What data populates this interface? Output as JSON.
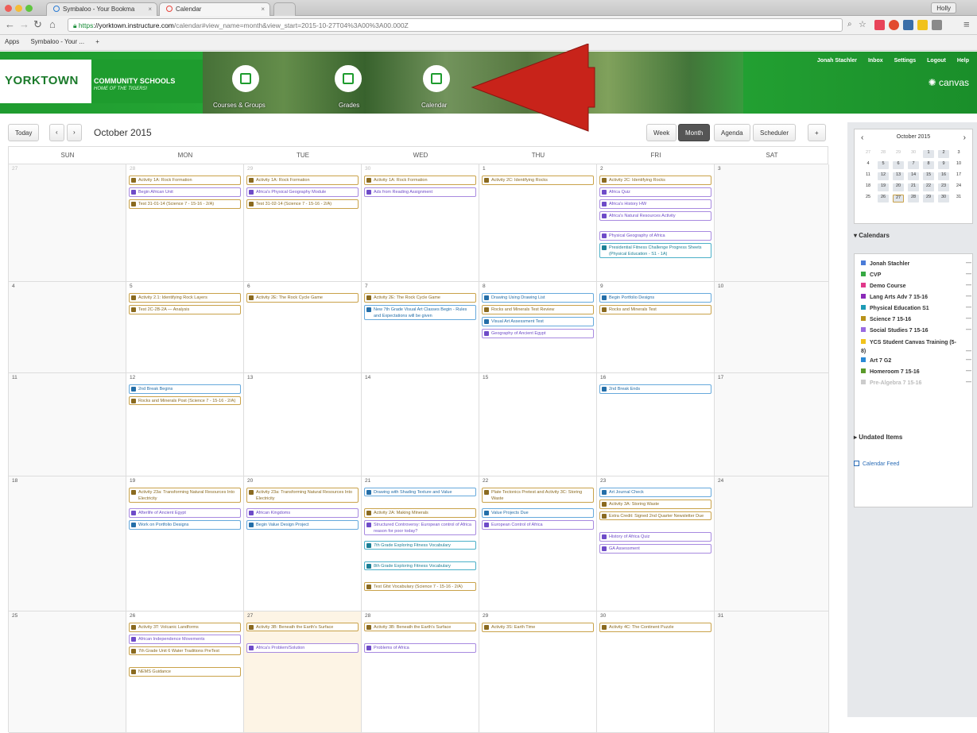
{
  "browser": {
    "tabs": [
      {
        "label": "Symbaloo - Your Bookma",
        "active": false
      },
      {
        "label": "Calendar",
        "active": true
      }
    ],
    "profile": "Holly",
    "url_secure": "https",
    "url_host": "://yorktown.instructure.com",
    "url_path": "/calendar#view_name=month&view_start=2015-10-27T04%3A00%3A00.000Z",
    "bookmarks": [
      "Apps",
      "Symbaloo - Your ...",
      "+"
    ]
  },
  "header": {
    "school_name": "YORKTOWN",
    "school_sub": "COMMUNITY SCHOOLS",
    "tagline": "HOME OF THE TIGERS!",
    "nav": [
      {
        "label": "Courses & Groups",
        "icon": "book-icon"
      },
      {
        "label": "Grades",
        "icon": "grades-icon"
      },
      {
        "label": "Calendar",
        "icon": "calendar-icon"
      }
    ],
    "user_links": [
      "Jonah Stachler",
      "Inbox",
      "Settings",
      "Logout",
      "Help"
    ],
    "brand": "canvas",
    "brand_color": "#21a534"
  },
  "toolbar": {
    "today_label": "Today",
    "prev_label": "‹",
    "next_label": "›",
    "month_title": "October 2015",
    "views": [
      "Week",
      "Month",
      "Agenda",
      "Scheduler"
    ],
    "selected_view": "Month",
    "add_label": "+"
  },
  "calendar": {
    "day_headers": [
      "SUN",
      "MON",
      "TUE",
      "WED",
      "THU",
      "FRI",
      "SAT"
    ],
    "weeks": [
      {
        "days": [
          {
            "num": "27",
            "dim": true,
            "events": []
          },
          {
            "num": "28",
            "dim": true,
            "events": [
              {
                "title": "Activity 1A: Rock Formation",
                "color": "olive"
              },
              {
                "title": "Begin African Unit",
                "color": "purple"
              },
              {
                "title": "Test 31-01-14 (Science 7 - 15-16 - 2/A)",
                "color": "olive"
              }
            ]
          },
          {
            "num": "29",
            "dim": true,
            "events": [
              {
                "title": "Activity 1A: Rock Formation",
                "color": "olive"
              },
              {
                "title": "Africa's Physical Geography Module",
                "color": "purple"
              },
              {
                "title": "Test 31-02-14 (Science 7 - 15-16 - 2/A)",
                "color": "olive"
              }
            ]
          },
          {
            "num": "30",
            "dim": true,
            "events": [
              {
                "title": "Activity 1A: Rock Formation",
                "color": "olive"
              },
              {
                "title": "Ads from Reading Assignment",
                "color": "purple"
              }
            ]
          },
          {
            "num": "1",
            "dim": false,
            "events": [
              {
                "title": "Activity 2C: Identifying Rocks",
                "color": "olive"
              }
            ]
          },
          {
            "num": "2",
            "dim": false,
            "events": [
              {
                "title": "Activity 2C: Identifying Rocks",
                "color": "olive"
              },
              {
                "title": "Africa Quiz",
                "color": "purple"
              },
              {
                "title": "Africa's History HW",
                "color": "purple"
              },
              {
                "title": "Africa's Natural Resources Activity",
                "color": "purple"
              },
              {
                "title": "Physical Geography of Africa",
                "color": "purple"
              },
              {
                "title": "Presidential Fitness Challenge Progress Sheets (Physical Education - S1 - 1A)",
                "color": "teal",
                "tall": true
              }
            ]
          },
          {
            "num": "3",
            "dim": false,
            "events": []
          }
        ]
      },
      {
        "days": [
          {
            "num": "4",
            "dim": false,
            "events": []
          },
          {
            "num": "5",
            "dim": false,
            "events": [
              {
                "title": "Activity 2.1: Identifying Rock Layers",
                "color": "olive"
              },
              {
                "title": "Test 2C-2B-2A — Analysis",
                "color": "olive"
              }
            ]
          },
          {
            "num": "6",
            "dim": false,
            "events": [
              {
                "title": "Activity 2E: The Rock Cycle Game",
                "color": "olive"
              }
            ]
          },
          {
            "num": "7",
            "dim": false,
            "events": [
              {
                "title": "Activity 2E: The Rock Cycle Game",
                "color": "olive"
              },
              {
                "title": "New 7th Grade Visual Art Classes Begin - Rules and Expectations will be given",
                "color": "blue",
                "tall": true
              }
            ]
          },
          {
            "num": "8",
            "dim": false,
            "events": [
              {
                "title": "Drawing Using Drawing List",
                "color": "blue"
              },
              {
                "title": "Rocks and Minerals Test Review",
                "color": "olive"
              },
              {
                "title": "Visual Art Assessment Test",
                "color": "blue"
              },
              {
                "title": "Geography of Ancient Egypt",
                "color": "purple"
              }
            ]
          },
          {
            "num": "9",
            "dim": false,
            "events": [
              {
                "title": "Begin Portfolio Designs",
                "color": "blue"
              },
              {
                "title": "Rocks and Minerals Test",
                "color": "olive"
              }
            ]
          },
          {
            "num": "10",
            "dim": false,
            "events": []
          }
        ]
      },
      {
        "days": [
          {
            "num": "11",
            "dim": false,
            "events": []
          },
          {
            "num": "12",
            "dim": false,
            "events": [
              {
                "title": "2nd Break Begins",
                "color": "blue"
              },
              {
                "title": "Rocks and Minerals Post (Science 7 - 15-16 - 2/A)",
                "color": "olive",
                "tall": true
              }
            ]
          },
          {
            "num": "13",
            "dim": false,
            "events": []
          },
          {
            "num": "14",
            "dim": false,
            "events": []
          },
          {
            "num": "15",
            "dim": false,
            "events": []
          },
          {
            "num": "16",
            "dim": false,
            "events": [
              {
                "title": "2nd Break Ends",
                "color": "blue"
              }
            ]
          },
          {
            "num": "17",
            "dim": false,
            "events": []
          }
        ]
      },
      {
        "days": [
          {
            "num": "18",
            "dim": false,
            "events": []
          },
          {
            "num": "19",
            "dim": false,
            "events": [
              {
                "title": "Activity 23a: Transforming Natural Resources Into Electricity",
                "color": "olive",
                "tall": true
              },
              {
                "title": "Afterlife of Ancient Egypt",
                "color": "purple"
              },
              {
                "title": "Work on Portfolio Designs",
                "color": "blue"
              }
            ]
          },
          {
            "num": "20",
            "dim": false,
            "events": [
              {
                "title": "Activity 23a: Transforming Natural Resources Into Electricity",
                "color": "olive",
                "tall": true
              },
              {
                "title": "African Kingdoms",
                "color": "purple"
              },
              {
                "title": "Begin Value Design Project",
                "color": "blue"
              }
            ]
          },
          {
            "num": "21",
            "dim": false,
            "events": [
              {
                "title": "Drawing with Shading Texture and Value",
                "color": "blue",
                "tall": true
              },
              {
                "title": "Activity 2A: Making Minerals",
                "color": "olive"
              },
              {
                "title": "Structured Controversy: European control of Africa reason for poor today?",
                "color": "purple",
                "tall": true
              },
              {
                "title": "7th Grade Exploring Fitness Vocabulary",
                "color": "teal",
                "tall": true
              },
              {
                "title": "8th Grade Exploring Fitness Vocabulary",
                "color": "teal",
                "tall": true
              },
              {
                "title": "Test Gfst Vocabulary (Science 7 - 15-16 - 2/A)",
                "color": "olive",
                "tall": true
              }
            ]
          },
          {
            "num": "22",
            "dim": false,
            "events": [
              {
                "title": "Plate Tectonics Pretest and Activity 3C: Storing Waste",
                "color": "olive",
                "tall": true
              },
              {
                "title": "Value Projects Due",
                "color": "blue"
              },
              {
                "title": "European Control of Africa",
                "color": "purple"
              }
            ]
          },
          {
            "num": "23",
            "dim": false,
            "events": [
              {
                "title": "Art Journal Check",
                "color": "blue"
              },
              {
                "title": "Activity 3A: Storing Waste",
                "color": "olive"
              },
              {
                "title": "Extra Credit: Signed 2nd Quarter Newsletter Due",
                "color": "olive",
                "tall": true
              },
              {
                "title": "History of Africa Quiz",
                "color": "purple"
              },
              {
                "title": "GA Assessment",
                "color": "purple"
              }
            ]
          },
          {
            "num": "24",
            "dim": false,
            "events": []
          }
        ]
      },
      {
        "days": [
          {
            "num": "25",
            "dim": false,
            "events": []
          },
          {
            "num": "26",
            "dim": false,
            "events": [
              {
                "title": "Activity 3T: Volcanic Landforms",
                "color": "olive"
              },
              {
                "title": "African Independence Movements",
                "color": "purple"
              },
              {
                "title": "7th Grade Unit 6 Water Traditions PreTest",
                "color": "olive",
                "tall": true
              },
              {
                "title": "NEMS Guidance",
                "color": "olive"
              }
            ]
          },
          {
            "num": "27",
            "dim": false,
            "today": true,
            "events": [
              {
                "title": "Activity 3B: Beneath the Earth's Surface",
                "color": "olive",
                "tall": true
              },
              {
                "title": "Africa's Problem/Solution",
                "color": "purple"
              }
            ]
          },
          {
            "num": "28",
            "dim": false,
            "events": [
              {
                "title": "Activity 3B: Beneath the Earth's Surface",
                "color": "olive",
                "tall": true
              },
              {
                "title": "Problems of Africa",
                "color": "purple"
              }
            ]
          },
          {
            "num": "29",
            "dim": false,
            "events": [
              {
                "title": "Activity 3S: Earth Time",
                "color": "olive"
              }
            ]
          },
          {
            "num": "30",
            "dim": false,
            "events": [
              {
                "title": "Activity 4C: The Continent Puzzle",
                "color": "olive"
              }
            ]
          },
          {
            "num": "31",
            "dim": false,
            "events": []
          }
        ]
      }
    ]
  },
  "sidebar": {
    "mini_title": "October 2015",
    "mini_weeks": [
      [
        "27",
        "28",
        "29",
        "30",
        "1",
        "2",
        "3"
      ],
      [
        "4",
        "5",
        "6",
        "7",
        "8",
        "9",
        "10"
      ],
      [
        "11",
        "12",
        "13",
        "14",
        "15",
        "16",
        "17"
      ],
      [
        "18",
        "19",
        "20",
        "21",
        "22",
        "23",
        "24"
      ],
      [
        "25",
        "26",
        "27",
        "28",
        "29",
        "30",
        "31"
      ]
    ],
    "calendars_heading": "Calendars",
    "calendars": [
      {
        "name": "Jonah Stachler",
        "color": "#4a7bd8"
      },
      {
        "name": "CVP",
        "color": "#36a943"
      },
      {
        "name": "Demo Course",
        "color": "#e0388a"
      },
      {
        "name": "Lang Arts Adv 7 15-16",
        "color": "#8a2ab8"
      },
      {
        "name": "Physical Education S1",
        "color": "#1d9bb5"
      },
      {
        "name": "Science 7 15-16",
        "color": "#b8921a"
      },
      {
        "name": "Social Studies 7 15-16",
        "color": "#9a6ae0"
      },
      {
        "name": "YCS Student Canvas Training (5-8)",
        "color": "#f1c21b"
      },
      {
        "name": "Art 7 G2",
        "color": "#2a8ad6"
      },
      {
        "name": "Homeroom 7 15-16",
        "color": "#5a9a2a"
      },
      {
        "name": "Pre-Algebra 7 15-16",
        "color": "#cccccc"
      }
    ],
    "more_label": "—",
    "undated_heading": "Undated Items",
    "feed_label": "Calendar Feed"
  }
}
